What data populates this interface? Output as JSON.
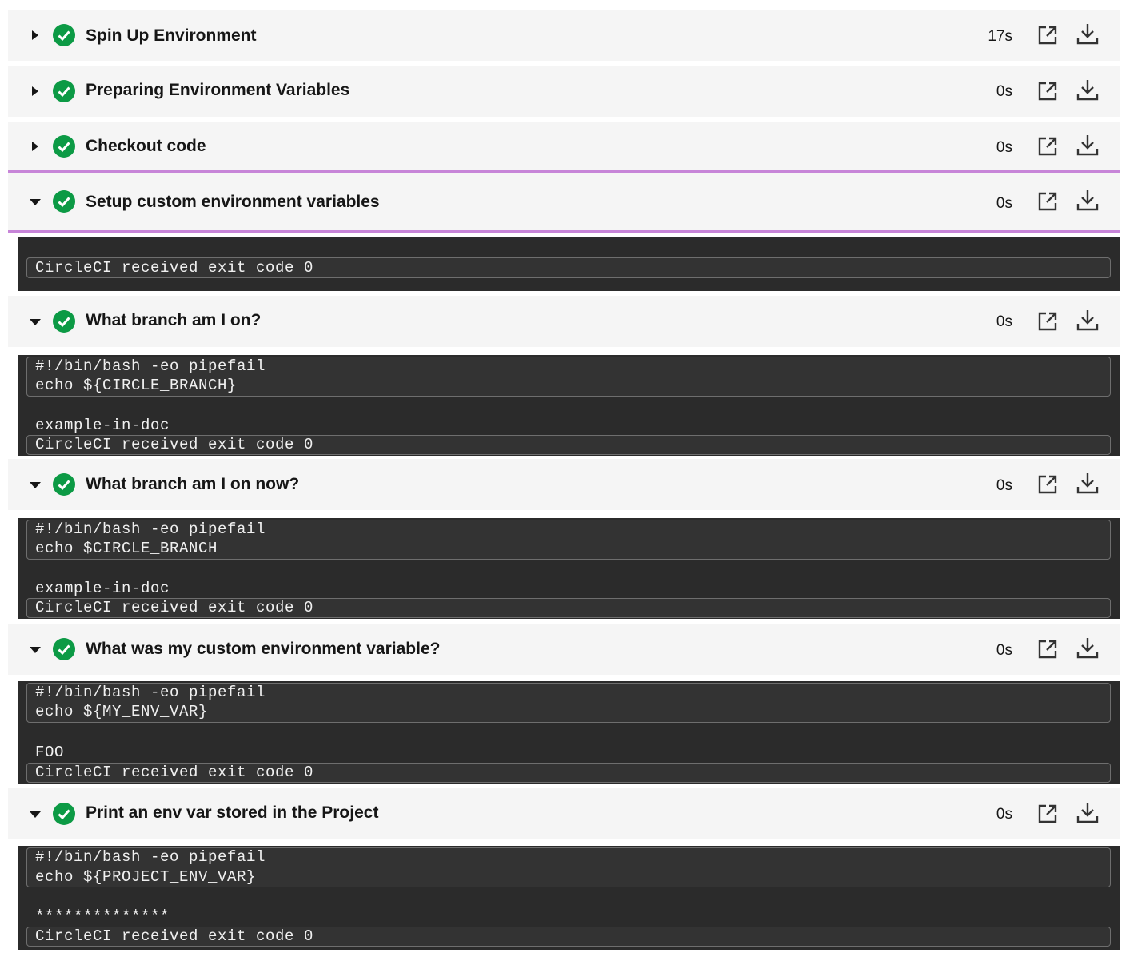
{
  "colors": {
    "success": "#0c9a45",
    "selected_border": "#c785d8",
    "row_bg": "#f5f5f5",
    "terminal_bg": "#2b2b2b"
  },
  "icons": {
    "expand": "caret-right-icon",
    "collapse": "caret-down-icon",
    "status": "check-circle-icon",
    "open": "open-external-icon",
    "download": "download-icon"
  },
  "steps": [
    {
      "title": "Spin Up Environment",
      "duration": "17s",
      "expanded": false
    },
    {
      "title": "Preparing Environment Variables",
      "duration": "0s",
      "expanded": false
    },
    {
      "title": "Checkout code",
      "duration": "0s",
      "expanded": false
    },
    {
      "title": "Setup custom environment variables",
      "duration": "0s",
      "expanded": true,
      "selected": true,
      "output": {
        "exit": "CircleCI received exit code 0"
      }
    },
    {
      "title": "What branch am I on?",
      "duration": "0s",
      "expanded": true,
      "output": {
        "command": [
          "#!/bin/bash -eo pipefail",
          "echo ${CIRCLE_BRANCH}"
        ],
        "result": "example-in-doc",
        "exit": "CircleCI received exit code 0"
      }
    },
    {
      "title": "What branch am I on now?",
      "duration": "0s",
      "expanded": true,
      "output": {
        "command": [
          "#!/bin/bash -eo pipefail",
          "echo $CIRCLE_BRANCH"
        ],
        "result": "example-in-doc",
        "exit": "CircleCI received exit code 0"
      }
    },
    {
      "title": "What was my custom environment variable?",
      "duration": "0s",
      "expanded": true,
      "output": {
        "command": [
          "#!/bin/bash -eo pipefail",
          "echo ${MY_ENV_VAR}"
        ],
        "result": "FOO",
        "exit": "CircleCI received exit code 0"
      }
    },
    {
      "title": "Print an env var stored in the Project",
      "duration": "0s",
      "expanded": true,
      "output": {
        "command": [
          "#!/bin/bash -eo pipefail",
          "echo ${PROJECT_ENV_VAR}"
        ],
        "result": "**************",
        "exit": "CircleCI received exit code 0"
      }
    }
  ]
}
